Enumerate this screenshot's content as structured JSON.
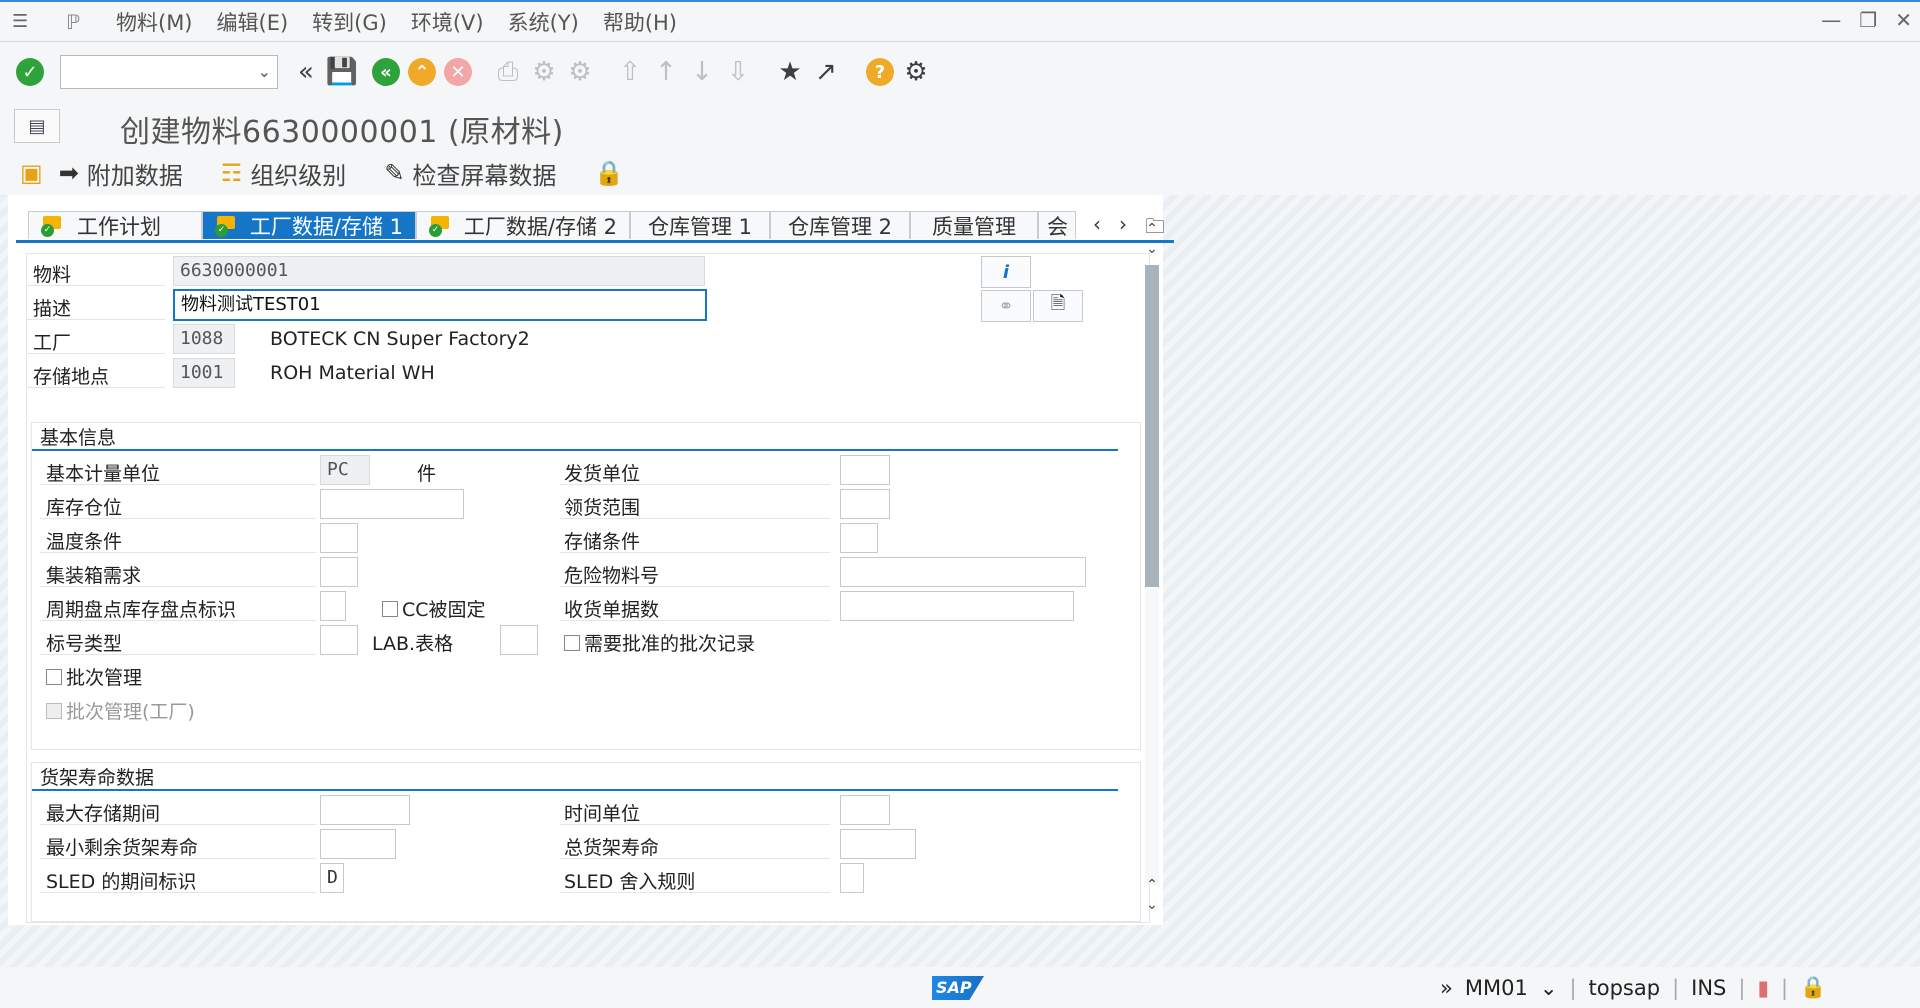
{
  "menu": {
    "items": [
      "物料(M)",
      "编辑(E)",
      "转到(G)",
      "环境(V)",
      "系统(Y)",
      "帮助(H)"
    ]
  },
  "toolbar": {
    "command_value": ""
  },
  "title": "创建物料6630000001 (原材料)",
  "app_toolbar": {
    "additional_data": "附加数据",
    "org_levels": "组织级别",
    "check_screen": "检查屏幕数据"
  },
  "tabs": [
    {
      "label": "工作计划",
      "active": false
    },
    {
      "label": "工厂数据/存储 1",
      "active": true
    },
    {
      "label": "工厂数据/存储 2",
      "active": false
    },
    {
      "label": "仓库管理 1",
      "active": false
    },
    {
      "label": "仓库管理 2",
      "active": false
    },
    {
      "label": "质量管理",
      "active": false
    },
    {
      "label": "会",
      "active": false
    }
  ],
  "header": {
    "material_label": "物料",
    "material_value": "6630000001",
    "desc_label": "描述",
    "desc_value": "物料测试TEST01",
    "plant_label": "工厂",
    "plant_value": "1088",
    "plant_name": "BOTECK CN Super Factory2",
    "sloc_label": "存储地点",
    "sloc_value": "1001",
    "sloc_name": "ROH Material WH"
  },
  "basic": {
    "title": "基本信息",
    "base_uom_label": "基本计量单位",
    "base_uom_value": "PC",
    "base_uom_text": "件",
    "storage_bin_label": "库存仓位",
    "storage_bin_value": "",
    "temp_cond_label": "温度条件",
    "temp_cond_value": "",
    "container_label": "集装箱需求",
    "container_value": "",
    "cycle_count_label": "周期盘点库存盘点标识",
    "cycle_count_value": "",
    "cc_fixed_label": "CC被固定",
    "label_type_label": "标号类型",
    "label_type_value": "",
    "lab_form_label": "LAB.表格",
    "lab_form_value": "",
    "batch_mgmt_label": "批次管理",
    "batch_mgmt_plant_label": "批次管理(工厂)",
    "unit_of_issue_label": "发货单位",
    "unit_of_issue_value": "",
    "picking_area_label": "领货范围",
    "picking_area_value": "",
    "storage_cond_label": "存储条件",
    "storage_cond_value": "",
    "haz_mat_label": "危险物料号",
    "haz_mat_value": "",
    "gr_slips_label": "收货单据数",
    "gr_slips_value": "",
    "approved_batch_label": "需要批准的批次记录"
  },
  "shelf": {
    "title": "货架寿命数据",
    "max_storage_label": "最大存储期间",
    "max_storage_value": "",
    "min_rem_label": "最小剩余货架寿命",
    "min_rem_value": "",
    "sled_period_label": "SLED 的期间标识",
    "sled_period_value": "D",
    "time_unit_label": "时间单位",
    "time_unit_value": "",
    "total_shelf_label": "总货架寿命",
    "total_shelf_value": "",
    "sled_rounding_label": "SLED 舍入规则",
    "sled_rounding_value": ""
  },
  "status": {
    "transaction": "MM01",
    "server": "topsap",
    "mode": "INS"
  },
  "colors": {
    "accent": "#1575c7",
    "ok_green": "#2fa33b",
    "warn_orange": "#f0a928"
  }
}
